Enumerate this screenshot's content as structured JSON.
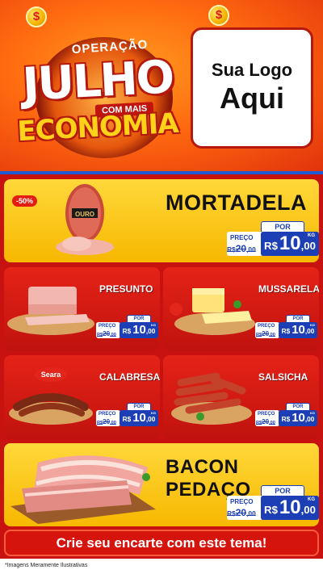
{
  "header": {
    "coin_symbol": "$",
    "campaign_top": "OPERAÇÃO",
    "campaign_main": "JULHO",
    "campaign_tag": "COM MAIS",
    "campaign_bottom": "ECONOMIA",
    "logo_line1": "Sua Logo",
    "logo_line2": "Aqui"
  },
  "products": {
    "mortadela": {
      "name": "MORTADELA",
      "discount": "-50%",
      "brand": "OURO",
      "por": "POR",
      "preco": "PREÇO",
      "old_int": "20",
      "old_cents": ",00",
      "old_prefix": "R$",
      "rs": "R$",
      "int": "10",
      "cents": ",00",
      "unit": "KG"
    },
    "presunto": {
      "name": "PRESUNTO",
      "por": "POR",
      "preco": "PREÇO",
      "old_int": "20",
      "old_cents": ",00",
      "old_prefix": "R$",
      "rs": "R$",
      "int": "10",
      "cents": ",00",
      "unit": "KG"
    },
    "mussarela": {
      "name": "MUSSARELA",
      "por": "POR",
      "preco": "PREÇO",
      "old_int": "20",
      "old_cents": ",00",
      "old_prefix": "R$",
      "rs": "R$",
      "int": "10",
      "cents": ",00",
      "unit": "KG"
    },
    "calabresa": {
      "name": "CALABRESA",
      "brand": "Seara",
      "por": "POR",
      "preco": "PREÇO",
      "old_int": "20",
      "old_cents": ",00",
      "old_prefix": "R$",
      "rs": "R$",
      "int": "10",
      "cents": ",00",
      "unit": "KG"
    },
    "salsicha": {
      "name": "SALSICHA",
      "por": "POR",
      "preco": "PREÇO",
      "old_int": "20",
      "old_cents": ",00",
      "old_prefix": "R$",
      "rs": "R$",
      "int": "10",
      "cents": ",00",
      "unit": "KG"
    },
    "bacon": {
      "name": "BACON PEDAÇO",
      "por": "POR",
      "preco": "PREÇO",
      "old_int": "20",
      "old_cents": ",00",
      "old_prefix": "R$",
      "rs": "R$",
      "int": "10",
      "cents": ",00",
      "unit": "KG"
    }
  },
  "cta": "Crie seu encarte com este tema!",
  "footnote": "*Imagens Meramente Ilustrativas",
  "colors": {
    "accent_blue": "#1c3fb5",
    "red": "#c8120f",
    "yellow": "#f7b800"
  }
}
